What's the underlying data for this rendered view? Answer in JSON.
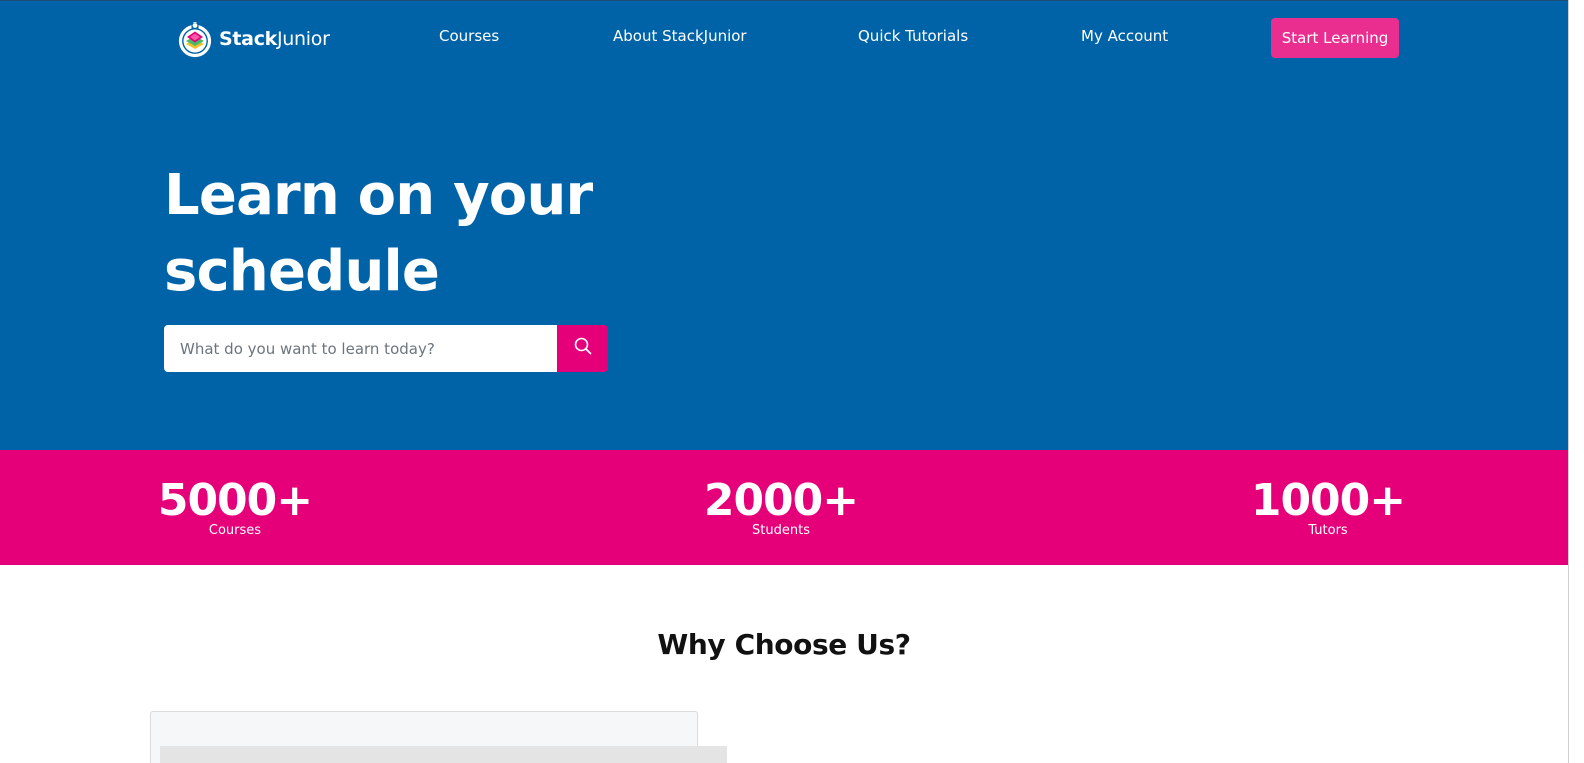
{
  "brand": {
    "name_bold": "Stack",
    "name_regular": "Junior",
    "logo_icon": "stackjunior-book-logo-icon"
  },
  "nav": {
    "items": [
      {
        "label": "Courses"
      },
      {
        "label": "About StackJunior"
      },
      {
        "label": "Quick Tutorials"
      },
      {
        "label": "My Account"
      }
    ],
    "cta_label": "Start Learning"
  },
  "hero": {
    "title": "Learn on your schedule",
    "search": {
      "placeholder": "What do you want to learn today?",
      "value": "",
      "button_icon": "search-icon"
    }
  },
  "stats": [
    {
      "value": "5000+",
      "label": "Courses"
    },
    {
      "value": "2000+",
      "label": "Students"
    },
    {
      "value": "1000+",
      "label": "Tutors"
    }
  ],
  "why": {
    "title": "Why Choose Us?"
  },
  "colors": {
    "hero_blue": "#0063a8",
    "brand_pink": "#e5007a",
    "cta_pink": "#ea2e8f",
    "white": "#ffffff",
    "heading_dark": "#111111"
  }
}
